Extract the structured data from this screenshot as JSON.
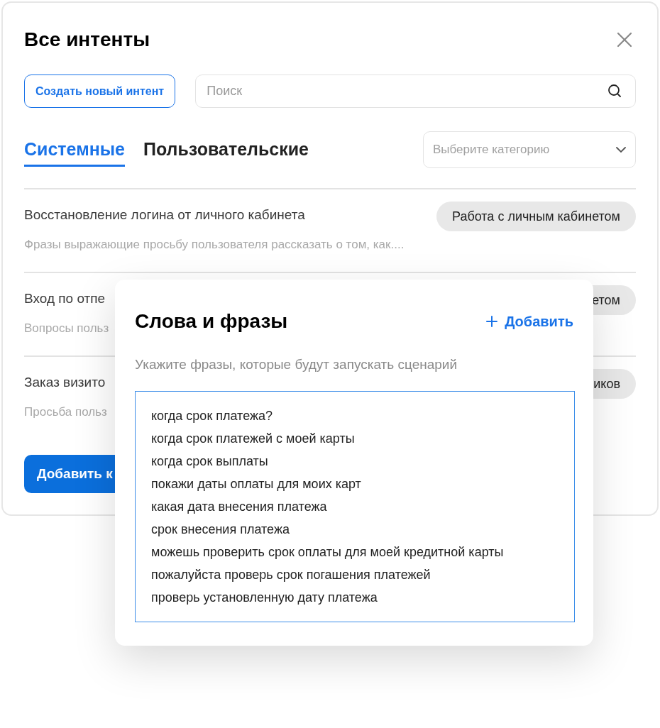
{
  "window": {
    "title": "Все интенты"
  },
  "create_button": "Создать новый интент",
  "search": {
    "placeholder": "Поиск"
  },
  "tabs": [
    {
      "label": "Системные",
      "selected": true
    },
    {
      "label": "Пользовательские",
      "selected": false
    }
  ],
  "category_select": {
    "placeholder": "Выберите категорию"
  },
  "intents": [
    {
      "title": "Восстановление логина от личного кабинета",
      "description": "Фразы выражающие просьбу пользователя рассказать о том, как....",
      "tag": "Работа с личным кабинетом"
    },
    {
      "title": "Вход по отпе",
      "description": "Вопросы польз",
      "tag": "етом"
    },
    {
      "title": "Заказ визито",
      "description": "Просьба польз",
      "tag": "иков"
    }
  ],
  "add_button": "Добавить к",
  "dialog": {
    "title": "Слова и фразы",
    "add_link": "Добавить",
    "hint": "Укажите фразы, которые будут запускать сценарий",
    "phrases": [
      "когда срок платежа?",
      "когда срок платежей с моей карты",
      "когда срок выплаты",
      "покажи даты оплаты для моих карт",
      "какая дата внесения платежа",
      "срок внесения платежа",
      "можешь проверить срок оплаты для моей кредитной карты",
      "пожалуйста проверь срок погашения платежей",
      "проверь установленную дату платежа"
    ]
  }
}
